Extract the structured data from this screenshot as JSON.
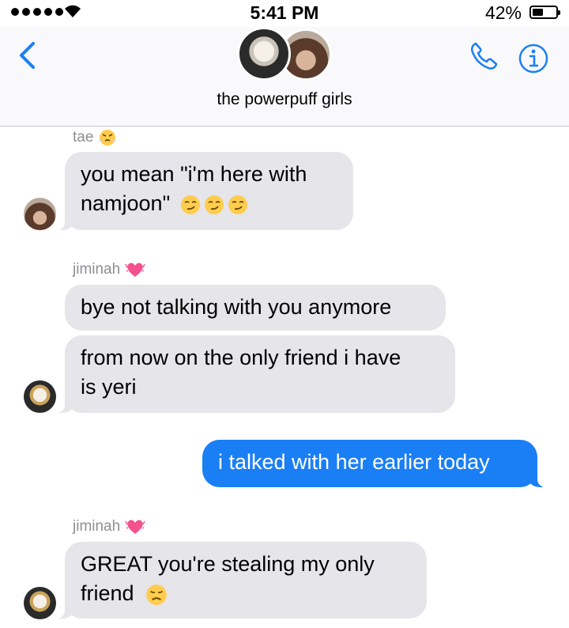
{
  "status_bar": {
    "time": "5:41 PM",
    "battery": "42%"
  },
  "nav": {
    "title": "the powerpuff girls"
  },
  "messages": [
    {
      "sender": "tae",
      "text_lines": [
        "you mean \"i'm here with",
        "namjoon\""
      ]
    },
    {
      "sender": "jiminah",
      "text": "bye not talking with you anymore"
    },
    {
      "text_lines": [
        "from now on the only friend i have",
        "is yeri"
      ]
    },
    {
      "text": "i talked with her earlier today"
    },
    {
      "sender": "jiminah",
      "text_lines": [
        "GREAT you're stealing my only",
        "friend"
      ]
    }
  ],
  "icons": [
    "back-chevron-icon",
    "phone-icon",
    "info-icon",
    "wifi-icon",
    "battery-icon"
  ],
  "colors": {
    "accent": "#1a7ff5",
    "incoming_bubble": "#e5e5ea",
    "sender_name": "#8e8e93"
  }
}
